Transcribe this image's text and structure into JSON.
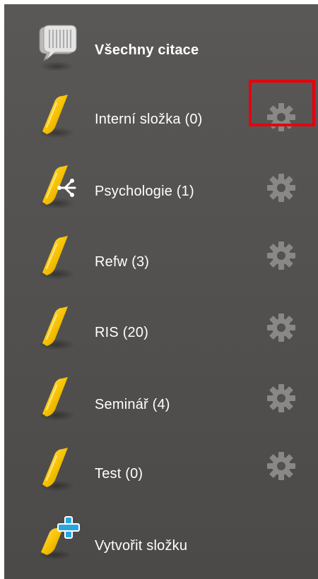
{
  "sidebar": {
    "all_citations": {
      "label": "Všechny citace",
      "icon": "speech-bubbles-icon"
    },
    "folders": [
      {
        "label": "Interní složka (0)",
        "icon": "folder-icon",
        "settings_icon": "gear-icon"
      },
      {
        "label": "Psychologie (1)",
        "icon": "shared-folder-icon",
        "settings_icon": "gear-icon"
      },
      {
        "label": "Refw (3)",
        "icon": "folder-icon",
        "settings_icon": "gear-icon"
      },
      {
        "label": "RIS (20)",
        "icon": "folder-icon",
        "settings_icon": "gear-icon"
      },
      {
        "label": "Seminář (4)",
        "icon": "folder-icon",
        "settings_icon": "gear-icon"
      },
      {
        "label": "Test (0)",
        "icon": "folder-icon",
        "settings_icon": "gear-icon"
      }
    ],
    "create_folder": {
      "label": "Vytvořit složku",
      "icon": "add-folder-icon"
    }
  },
  "colors": {
    "panel_bg": "#545250",
    "text": "#ffffff",
    "gear": "#8a8886",
    "folder": "#f5c000",
    "highlight": "#e6000e",
    "plus": "#2aa6df"
  }
}
